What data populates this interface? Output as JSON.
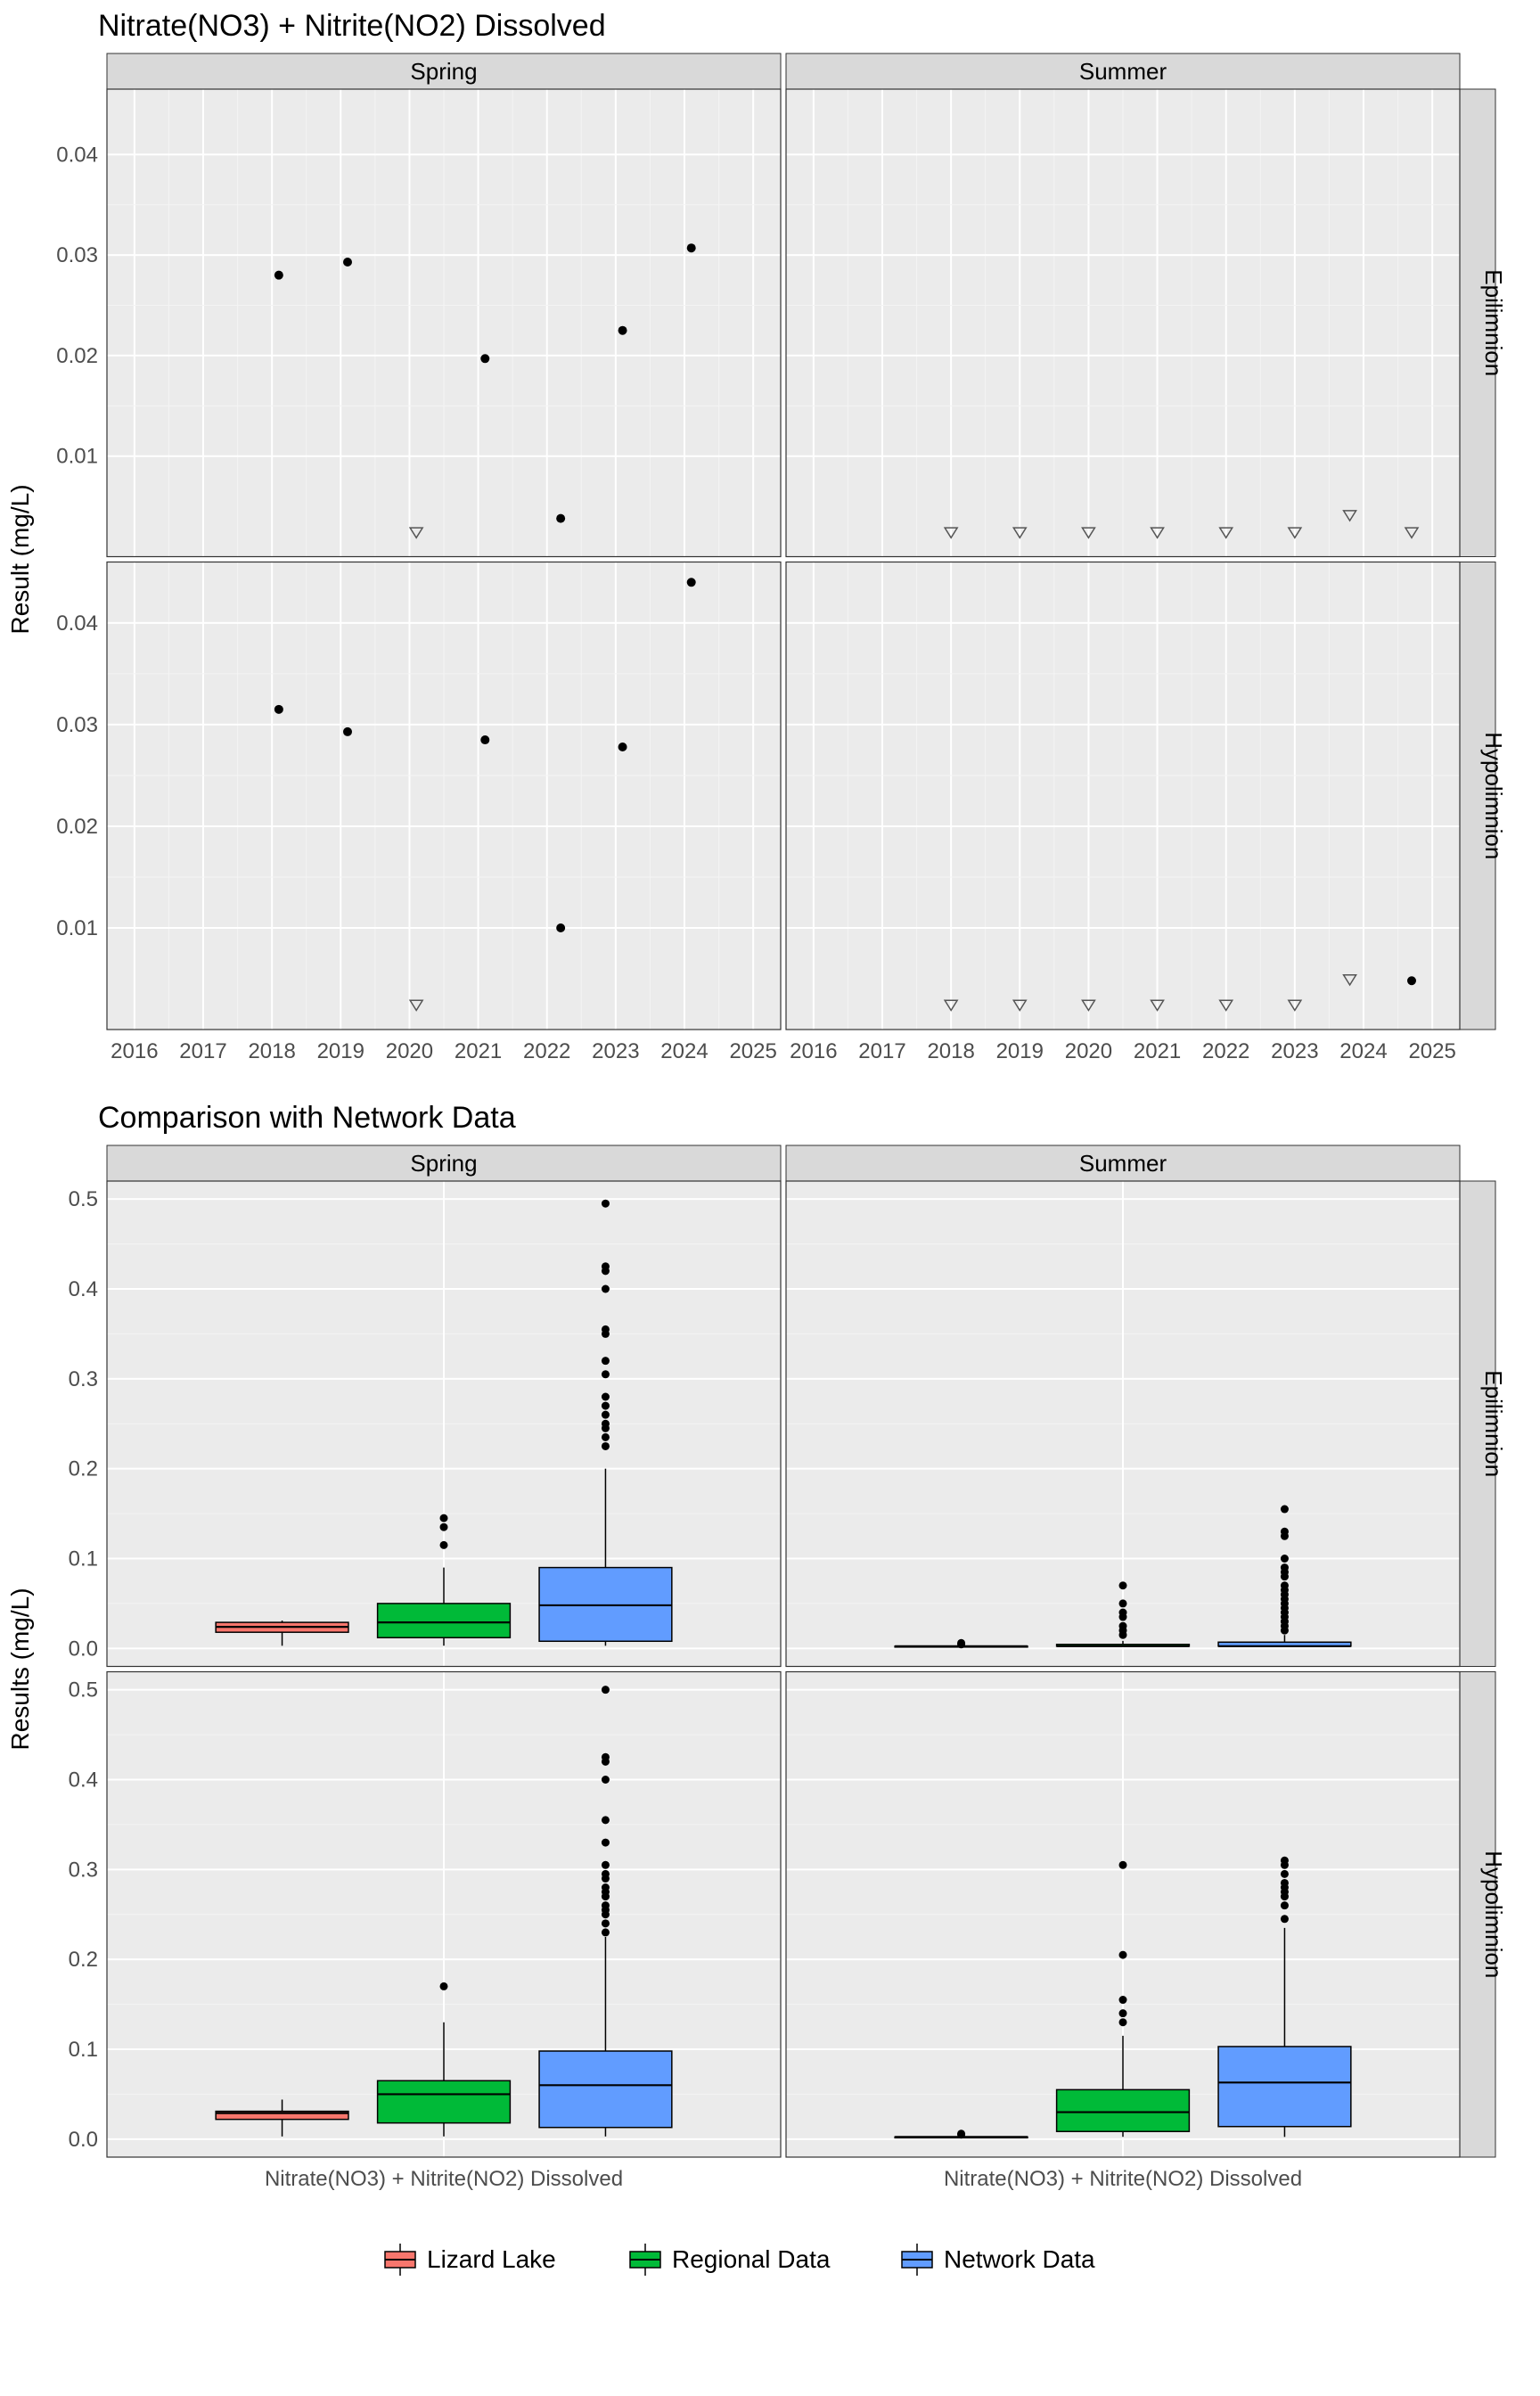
{
  "chart_data": [
    {
      "type": "scatter",
      "title": "Nitrate(NO3) + Nitrite(NO2) Dissolved",
      "ylabel": "Result (mg/L)",
      "x_ticks": [
        2016,
        2017,
        2018,
        2019,
        2020,
        2021,
        2022,
        2023,
        2024,
        2025
      ],
      "col_facets": [
        "Spring",
        "Summer"
      ],
      "row_facets": [
        "Epilimnion",
        "Hypolimnion"
      ],
      "y_ticks": {
        "Epilimnion": [
          0.01,
          0.02,
          0.03,
          0.04
        ],
        "Hypolimnion": [
          0.01,
          0.02,
          0.03,
          0.04
        ]
      },
      "xlim": [
        2015.6,
        2025.4
      ],
      "ylim": {
        "Epilimnion": [
          0,
          0.0465
        ],
        "Hypolimnion": [
          0,
          0.046
        ]
      },
      "panels": {
        "Spring|Epilimnion": {
          "points": [
            [
              2018.1,
              0.028
            ],
            [
              2019.1,
              0.0293
            ],
            [
              2021.1,
              0.0197
            ],
            [
              2022.2,
              0.0038
            ],
            [
              2023.1,
              0.0225
            ],
            [
              2024.1,
              0.0307
            ]
          ],
          "triangles": [
            [
              2020.1,
              0.0025
            ]
          ]
        },
        "Summer|Epilimnion": {
          "points": [],
          "triangles": [
            [
              2018.0,
              0.0025
            ],
            [
              2019.0,
              0.0025
            ],
            [
              2020.0,
              0.0025
            ],
            [
              2021.0,
              0.0025
            ],
            [
              2022.0,
              0.0025
            ],
            [
              2023.0,
              0.0025
            ],
            [
              2023.8,
              0.0042
            ],
            [
              2024.7,
              0.0025
            ]
          ]
        },
        "Spring|Hypolimnion": {
          "points": [
            [
              2018.1,
              0.0315
            ],
            [
              2019.1,
              0.0293
            ],
            [
              2021.1,
              0.0285
            ],
            [
              2022.2,
              0.01
            ],
            [
              2023.1,
              0.0278
            ],
            [
              2024.1,
              0.044
            ]
          ],
          "triangles": [
            [
              2020.1,
              0.0025
            ]
          ]
        },
        "Summer|Hypolimnion": {
          "points": [
            [
              2024.7,
              0.0048
            ]
          ],
          "triangles": [
            [
              2018.0,
              0.0025
            ],
            [
              2019.0,
              0.0025
            ],
            [
              2020.0,
              0.0025
            ],
            [
              2021.0,
              0.0025
            ],
            [
              2022.0,
              0.0025
            ],
            [
              2023.0,
              0.0025
            ],
            [
              2023.8,
              0.005
            ]
          ]
        }
      }
    },
    {
      "type": "box",
      "title": "Comparison with Network Data",
      "ylabel": "Results (mg/L)",
      "x_category": "Nitrate(NO3) + Nitrite(NO2) Dissolved",
      "col_facets": [
        "Spring",
        "Summer"
      ],
      "row_facets": [
        "Epilimnion",
        "Hypolimnion"
      ],
      "y_ticks": [
        0.0,
        0.1,
        0.2,
        0.3,
        0.4,
        0.5
      ],
      "ylim": [
        -0.02,
        0.52
      ],
      "series": [
        {
          "name": "Lizard Lake",
          "color": "#F8766D"
        },
        {
          "name": "Regional Data",
          "color": "#00BA38"
        },
        {
          "name": "Network Data",
          "color": "#619CFF"
        }
      ],
      "panels": {
        "Spring|Epilimnion": {
          "boxes": [
            {
              "series": "Lizard Lake",
              "min": 0.003,
              "q1": 0.018,
              "median": 0.024,
              "q3": 0.029,
              "max": 0.031,
              "outliers": []
            },
            {
              "series": "Regional Data",
              "min": 0.003,
              "q1": 0.012,
              "median": 0.029,
              "q3": 0.05,
              "max": 0.09,
              "outliers": [
                0.115,
                0.135,
                0.145
              ]
            },
            {
              "series": "Network Data",
              "min": 0.003,
              "q1": 0.008,
              "median": 0.048,
              "q3": 0.09,
              "max": 0.2,
              "outliers": [
                0.225,
                0.235,
                0.245,
                0.25,
                0.26,
                0.27,
                0.28,
                0.305,
                0.32,
                0.35,
                0.355,
                0.4,
                0.42,
                0.425,
                0.495
              ]
            }
          ]
        },
        "Summer|Epilimnion": {
          "boxes": [
            {
              "series": "Lizard Lake",
              "min": 0.0025,
              "q1": 0.0025,
              "median": 0.0025,
              "q3": 0.0025,
              "max": 0.0025,
              "outliers": [
                0.0045,
                0.006
              ]
            },
            {
              "series": "Regional Data",
              "min": 0.0025,
              "q1": 0.0025,
              "median": 0.0025,
              "q3": 0.0045,
              "max": 0.0085,
              "outliers": [
                0.015,
                0.02,
                0.025,
                0.035,
                0.04,
                0.05,
                0.07
              ]
            },
            {
              "series": "Network Data",
              "min": 0.0025,
              "q1": 0.0025,
              "median": 0.0025,
              "q3": 0.007,
              "max": 0.015,
              "outliers": [
                0.02,
                0.025,
                0.03,
                0.035,
                0.04,
                0.045,
                0.05,
                0.055,
                0.06,
                0.065,
                0.07,
                0.08,
                0.085,
                0.09,
                0.1,
                0.125,
                0.13,
                0.155
              ]
            }
          ]
        },
        "Spring|Hypolimnion": {
          "boxes": [
            {
              "series": "Lizard Lake",
              "min": 0.003,
              "q1": 0.022,
              "median": 0.029,
              "q3": 0.031,
              "max": 0.044,
              "outliers": []
            },
            {
              "series": "Regional Data",
              "min": 0.003,
              "q1": 0.018,
              "median": 0.05,
              "q3": 0.065,
              "max": 0.13,
              "outliers": [
                0.17
              ]
            },
            {
              "series": "Network Data",
              "min": 0.003,
              "q1": 0.013,
              "median": 0.06,
              "q3": 0.098,
              "max": 0.225,
              "outliers": [
                0.23,
                0.24,
                0.25,
                0.255,
                0.26,
                0.27,
                0.275,
                0.28,
                0.29,
                0.295,
                0.305,
                0.33,
                0.355,
                0.4,
                0.42,
                0.425,
                0.5
              ]
            }
          ]
        },
        "Summer|Hypolimnion": {
          "boxes": [
            {
              "series": "Lizard Lake",
              "min": 0.0025,
              "q1": 0.0025,
              "median": 0.0025,
              "q3": 0.0025,
              "max": 0.0025,
              "outliers": [
                0.005,
                0.006
              ]
            },
            {
              "series": "Regional Data",
              "min": 0.0025,
              "q1": 0.0085,
              "median": 0.03,
              "q3": 0.055,
              "max": 0.115,
              "outliers": [
                0.13,
                0.14,
                0.155,
                0.205,
                0.305
              ]
            },
            {
              "series": "Network Data",
              "min": 0.0025,
              "q1": 0.014,
              "median": 0.063,
              "q3": 0.103,
              "max": 0.235,
              "outliers": [
                0.245,
                0.26,
                0.27,
                0.275,
                0.28,
                0.285,
                0.295,
                0.305,
                0.31
              ]
            }
          ]
        }
      }
    }
  ],
  "legend": {
    "title": "",
    "items": [
      {
        "label": "Lizard Lake",
        "color": "#F8766D"
      },
      {
        "label": "Regional Data",
        "color": "#00BA38"
      },
      {
        "label": "Network Data",
        "color": "#619CFF"
      }
    ]
  }
}
